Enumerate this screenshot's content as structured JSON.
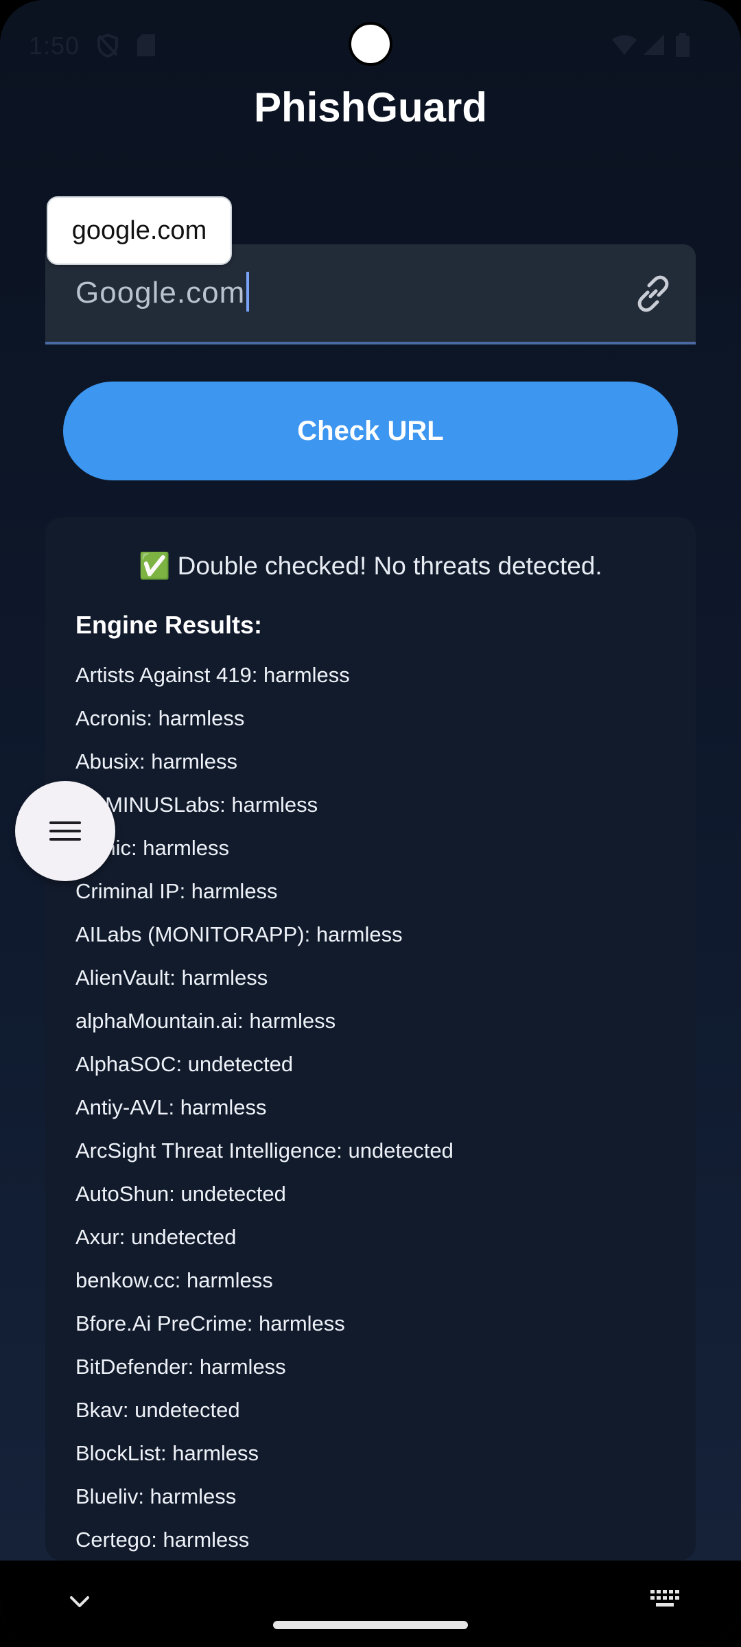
{
  "status_bar": {
    "time": "1:50",
    "icons": [
      "shield-off-icon",
      "sd-card-icon",
      "wifi-icon",
      "signal-icon",
      "battery-icon"
    ]
  },
  "app": {
    "title": "PhishGuard"
  },
  "url_input": {
    "value": "Google.com",
    "autofill_suggestion": "google.com",
    "trailing_icon": "link-icon"
  },
  "check_button": {
    "label": "Check URL"
  },
  "results": {
    "summary": "✅ Double checked! No threats detected.",
    "engine_heading": "Engine Results:",
    "engines": [
      "Artists Against 419: harmless",
      "Acronis: harmless",
      "Abusix: harmless",
      "ADMINUSLabs: harmless",
      "Lionic: harmless",
      "Criminal IP: harmless",
      "AILabs (MONITORAPP): harmless",
      "AlienVault: harmless",
      "alphaMountain.ai: harmless",
      "AlphaSOC: undetected",
      "Antiy-AVL: harmless",
      "ArcSight Threat Intelligence: undetected",
      "AutoShun: undetected",
      "Axur: undetected",
      "benkow.cc: harmless",
      "Bfore.Ai PreCrime: harmless",
      "BitDefender: harmless",
      "Bkav: undetected",
      "BlockList: harmless",
      "Blueliv: harmless",
      "Certego: harmless"
    ]
  },
  "fab": {
    "icon": "menu-icon"
  },
  "nav_bar": {
    "icons": [
      "chevron-down-icon",
      "keyboard-icon"
    ]
  },
  "colors": {
    "background": "#0b1220",
    "accent": "#3d96f0",
    "input_background": "#222b38",
    "card_background": "#121b2c"
  }
}
